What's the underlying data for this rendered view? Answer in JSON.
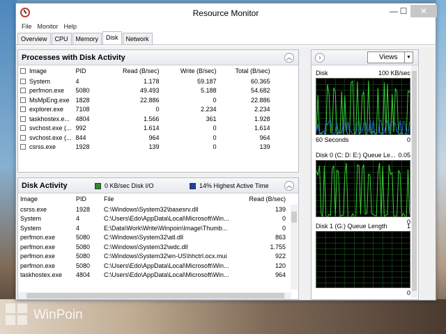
{
  "window": {
    "title": "Resource Monitor",
    "controls": {
      "minimize": "—",
      "maximize": "☐",
      "close": "✕"
    }
  },
  "menu": [
    "File",
    "Monitor",
    "Help"
  ],
  "tabs": [
    {
      "label": "Overview",
      "active": false
    },
    {
      "label": "CPU",
      "active": false
    },
    {
      "label": "Memory",
      "active": false
    },
    {
      "label": "Disk",
      "active": true
    },
    {
      "label": "Network",
      "active": false
    }
  ],
  "processes": {
    "title": "Processes with Disk Activity",
    "columns": [
      "Image",
      "PID",
      "Read (B/sec)",
      "Write (B/sec)",
      "Total (B/sec)"
    ],
    "rows": [
      [
        "System",
        "4",
        "1.178",
        "59.187",
        "60.365"
      ],
      [
        "perfmon.exe",
        "5080",
        "49.493",
        "5.188",
        "54.682"
      ],
      [
        "MsMpEng.exe",
        "1828",
        "22.886",
        "0",
        "22.886"
      ],
      [
        "explorer.exe",
        "7108",
        "0",
        "2.234",
        "2.234"
      ],
      [
        "taskhostex.e...",
        "4804",
        "1.566",
        "361",
        "1.928"
      ],
      [
        "svchost.exe (...",
        "992",
        "1.614",
        "0",
        "1.614"
      ],
      [
        "svchost.exe (...",
        "844",
        "964",
        "0",
        "964"
      ],
      [
        "csrss.exe",
        "1928",
        "139",
        "0",
        "139"
      ]
    ]
  },
  "disk_activity": {
    "title": "Disk Activity",
    "legend1": {
      "label": "0 KB/sec Disk I/O",
      "color": "#2e8b2e"
    },
    "legend2": {
      "label": "14% Highest Active Time",
      "color": "#1f3fa8"
    },
    "columns": [
      "Image",
      "PID",
      "File",
      "Read (B/sec)"
    ],
    "rows": [
      [
        "csrss.exe",
        "1928",
        "C:\\Windows\\System32\\basesrv.dll",
        "139"
      ],
      [
        "System",
        "4",
        "C:\\Users\\Edo\\AppData\\Local\\Microsoft\\Win...",
        "0"
      ],
      [
        "System",
        "4",
        "E:\\Data\\Work\\Write\\Winpoin\\Image\\Thumb...",
        "0"
      ],
      [
        "perfmon.exe",
        "5080",
        "C:\\Windows\\System32\\atl.dll",
        "863"
      ],
      [
        "perfmon.exe",
        "5080",
        "C:\\Windows\\System32\\wdc.dll",
        "1.755"
      ],
      [
        "perfmon.exe",
        "5080",
        "C:\\Windows\\System32\\en-US\\hhctrl.ocx.mui",
        "922"
      ],
      [
        "perfmon.exe",
        "5080",
        "C:\\Users\\Edo\\AppData\\Local\\Microsoft\\Win...",
        "120"
      ],
      [
        "taskhostex.exe",
        "4804",
        "C:\\Users\\Edo\\AppData\\Local\\Microsoft\\Win...",
        "964"
      ]
    ]
  },
  "right": {
    "views_label": "Views",
    "graphs": [
      {
        "label": "Disk",
        "scale": "100 KB/sec",
        "bottom_left": "60 Seconds",
        "bottom_right": "0"
      },
      {
        "label": "Disk 0 (C: D: E:) Queue Le...",
        "scale": "0.05",
        "bottom_left": "",
        "bottom_right": "0"
      },
      {
        "label": "Disk 1 (G:) Queue Length",
        "scale": "1",
        "bottom_left": "",
        "bottom_right": "0"
      }
    ],
    "colors": {
      "green": "#36d236",
      "blue": "#2a62d8",
      "grid": "#1d5a1d"
    }
  },
  "watermark": {
    "text": "WinPoin"
  }
}
